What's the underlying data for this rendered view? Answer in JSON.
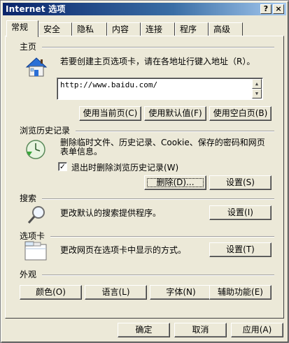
{
  "window": {
    "title": "Internet 选项",
    "help_label": "?",
    "close_label": "×"
  },
  "tabs": [
    {
      "label": "常规",
      "active": true
    },
    {
      "label": "安全"
    },
    {
      "label": "隐私"
    },
    {
      "label": "内容"
    },
    {
      "label": "连接"
    },
    {
      "label": "程序"
    },
    {
      "label": "高级"
    }
  ],
  "home": {
    "heading": "主页",
    "description": "若要创建主页选项卡，请在各地址行键入地址（R）。",
    "url": "http://www.baidu.com/",
    "use_current": "使用当前页(C)",
    "use_default": "使用默认值(F)",
    "use_blank": "使用空白页(B)"
  },
  "history": {
    "heading": "浏览历史记录",
    "description_line1": "删除临时文件、历史记录、Cookie、保存的密码和网页",
    "description_line2": "表单信息。",
    "checkbox_label": "退出时删除浏览历史记录(W)",
    "checkbox_checked": true,
    "checkbox_mark": "✓",
    "delete": "删除(D)...",
    "settings": "设置(S)"
  },
  "search": {
    "heading": "搜索",
    "description": "更改默认的搜索提供程序。",
    "settings": "设置(I)"
  },
  "tabs_section": {
    "heading": "选项卡",
    "description": "更改网页在选项卡中显示的方式。",
    "settings": "设置(T)"
  },
  "appearance": {
    "heading": "外观",
    "colors": "颜色(O)",
    "languages": "语言(L)",
    "fonts": "字体(N)",
    "accessibility": "辅助功能(E)"
  },
  "footer": {
    "ok": "确定",
    "cancel": "取消",
    "apply": "应用(A)"
  }
}
